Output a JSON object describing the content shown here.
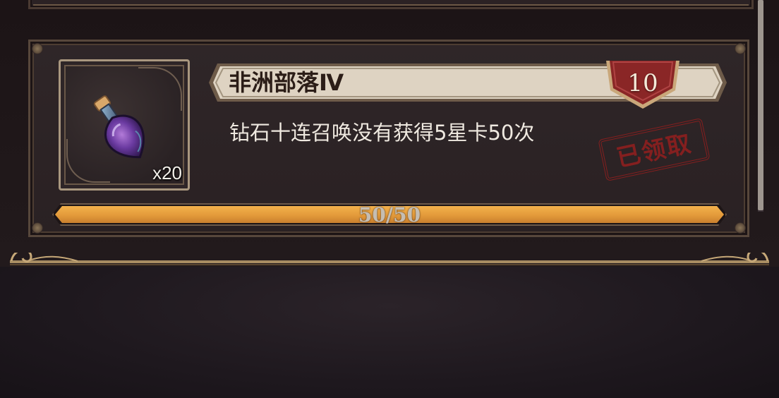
{
  "task": {
    "title": "非洲部落Ⅳ",
    "level_badge": "10",
    "description": "钻石十连召唤没有获得5星卡50次",
    "claimed_stamp": "已领取",
    "reward": {
      "icon": "purple-potion-icon",
      "quantity_label": "x20"
    },
    "progress": {
      "current": 50,
      "total": 50,
      "label": "50/50",
      "fraction": 1.0
    }
  },
  "colors": {
    "progress_fill": "#e39a3a",
    "badge_red": "#8a2626",
    "stamp_red": "#8e1f1f",
    "banner_cream": "#ded3c2"
  }
}
